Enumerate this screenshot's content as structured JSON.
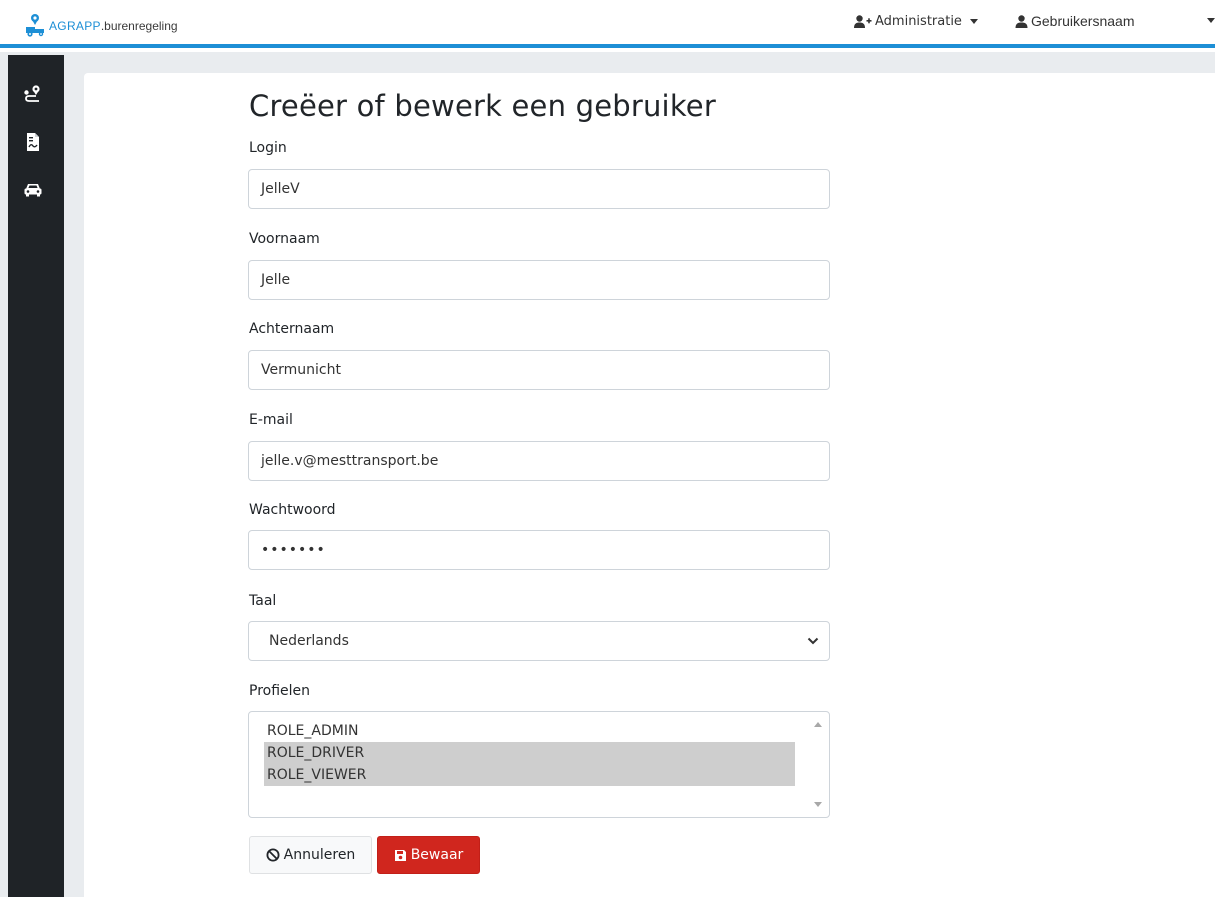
{
  "navbar": {
    "logo_brand": "AGRAPP",
    "logo_sub": ".burenregeling",
    "admin_label": "Administratie",
    "user_label": "Gebruikersnaam",
    "accent_color": "#1d8fd6"
  },
  "sidebar": {
    "icons": [
      "route-icon",
      "document-icon",
      "car-icon"
    ]
  },
  "form": {
    "title": "Creëer of bewerk een gebruiker",
    "login": {
      "label": "Login",
      "value": "JelleV"
    },
    "voornaam": {
      "label": "Voornaam",
      "value": "Jelle"
    },
    "achternaam": {
      "label": "Achternaam",
      "value": "Vermunicht"
    },
    "email": {
      "label": "E-mail",
      "value": "jelle.v@mesttransport.be"
    },
    "wachtwoord": {
      "label": "Wachtwoord",
      "value": "•••••••"
    },
    "taal": {
      "label": "Taal",
      "value": "Nederlands"
    },
    "profielen": {
      "label": "Profielen",
      "options": [
        {
          "label": "ROLE_ADMIN",
          "selected": false
        },
        {
          "label": "ROLE_DRIVER",
          "selected": true
        },
        {
          "label": "ROLE_VIEWER",
          "selected": true
        }
      ]
    }
  },
  "buttons": {
    "cancel_label": "Annuleren",
    "save_label": "Bewaar",
    "save_color": "#d0261e"
  }
}
